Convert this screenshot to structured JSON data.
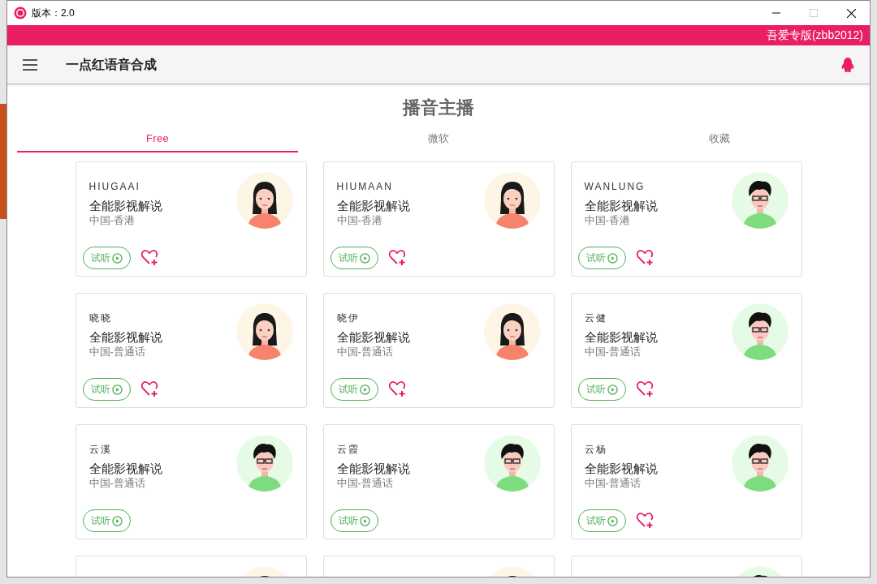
{
  "window": {
    "title": "版本：2.0"
  },
  "banner": {
    "text": "吾爱专版(zbb2012)"
  },
  "toolbar": {
    "title": "一点红语音合成"
  },
  "page": {
    "heading": "播音主播"
  },
  "tabs": [
    {
      "label": "Free",
      "selected": true
    },
    {
      "label": "微软",
      "selected": false
    },
    {
      "label": "收藏",
      "selected": false
    }
  ],
  "cards": [
    {
      "name": "HIUGAAI",
      "title": "全能影视解说",
      "locale": "中国-香港",
      "kind": "female",
      "listen": "试听",
      "favorite": true
    },
    {
      "name": "HIUMAAN",
      "title": "全能影视解说",
      "locale": "中国-香港",
      "kind": "female",
      "listen": "试听",
      "favorite": true
    },
    {
      "name": "WANLUNG",
      "title": "全能影视解说",
      "locale": "中国-香港",
      "kind": "male",
      "listen": "试听",
      "favorite": true
    },
    {
      "name": "晓晓",
      "title": "全能影视解说",
      "locale": "中国-普通话",
      "kind": "female",
      "listen": "试听",
      "favorite": true
    },
    {
      "name": "晓伊",
      "title": "全能影视解说",
      "locale": "中国-普通话",
      "kind": "female",
      "listen": "试听",
      "favorite": true
    },
    {
      "name": "云健",
      "title": "全能影视解说",
      "locale": "中国-普通话",
      "kind": "male",
      "listen": "试听",
      "favorite": true
    },
    {
      "name": "云溪",
      "title": "全能影视解说",
      "locale": "中国-普通话",
      "kind": "male",
      "listen": "试听",
      "favorite": false
    },
    {
      "name": "云霞",
      "title": "全能影视解说",
      "locale": "中国-普通话",
      "kind": "male",
      "listen": "试听",
      "favorite": false
    },
    {
      "name": "云杨",
      "title": "全能影视解说",
      "locale": "中国-普通话",
      "kind": "male",
      "listen": "试听",
      "favorite": true
    },
    {
      "kind": "female"
    },
    {
      "kind": "female"
    },
    {
      "kind": "male"
    }
  ]
}
